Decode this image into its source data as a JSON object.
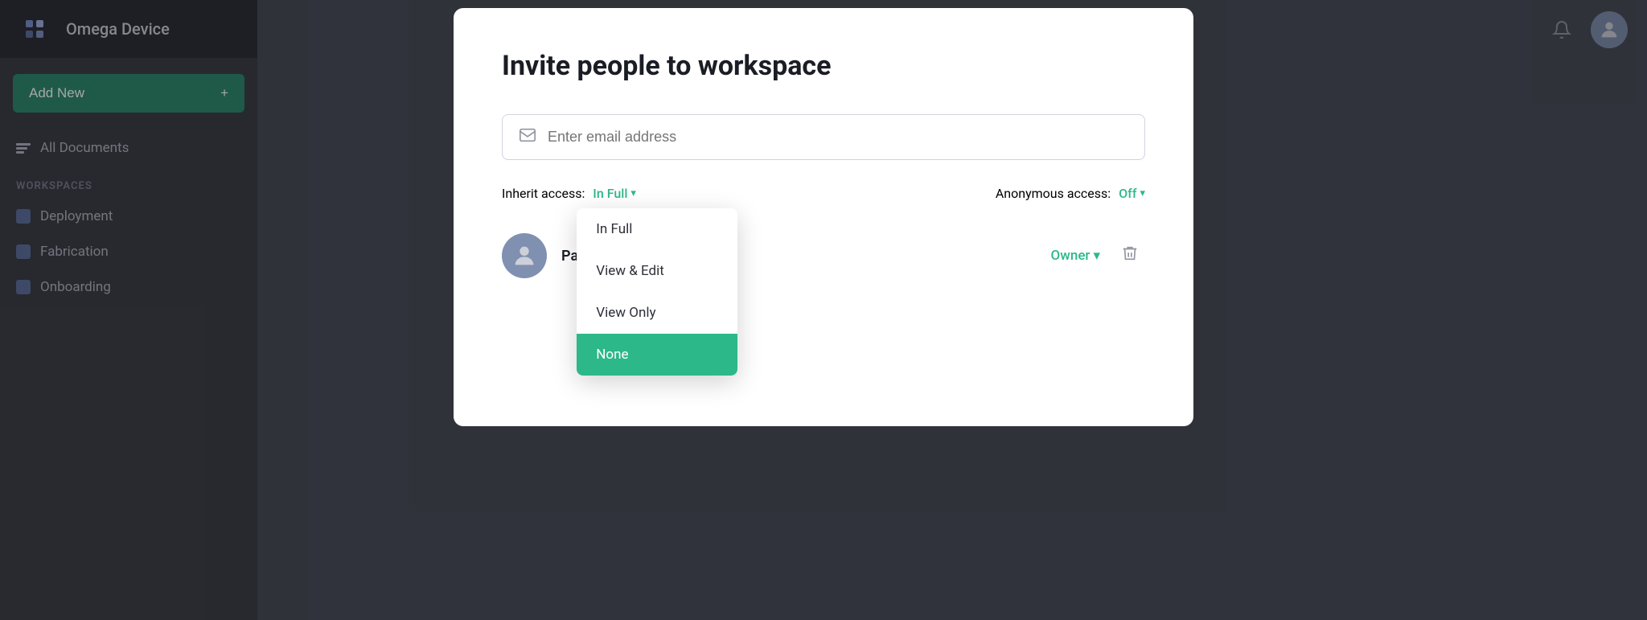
{
  "app": {
    "name": "Omega Device"
  },
  "sidebar": {
    "add_new_label": "Add New",
    "add_new_icon": "+",
    "all_documents_label": "All Documents",
    "workspaces_label": "WORKSPACES",
    "workspaces": [
      {
        "id": "deployment",
        "label": "Deployment"
      },
      {
        "id": "fabrication",
        "label": "Fabrication"
      },
      {
        "id": "onboarding",
        "label": "Onboarding"
      }
    ]
  },
  "modal": {
    "title": "Invite people to workspace",
    "email_placeholder": "Enter email address",
    "inherit_access_label": "Inherit access:",
    "inherit_access_value": "In Full",
    "anonymous_access_label": "Anonymous access:",
    "anonymous_access_value": "Off",
    "dropdown": {
      "options": [
        {
          "id": "in-full",
          "label": "In Full",
          "selected": false
        },
        {
          "id": "view-edit",
          "label": "View & Edit",
          "selected": false
        },
        {
          "id": "view-only",
          "label": "View Only",
          "selected": false
        },
        {
          "id": "none",
          "label": "None",
          "selected": true
        }
      ]
    },
    "member": {
      "name": "Paul",
      "role": "Owner",
      "role_chevron": "▾"
    }
  },
  "colors": {
    "green": "#2db88a",
    "green_dark": "#2e8b6e",
    "sidebar_bg": "#3d4049",
    "header_bg": "#2e3038"
  }
}
